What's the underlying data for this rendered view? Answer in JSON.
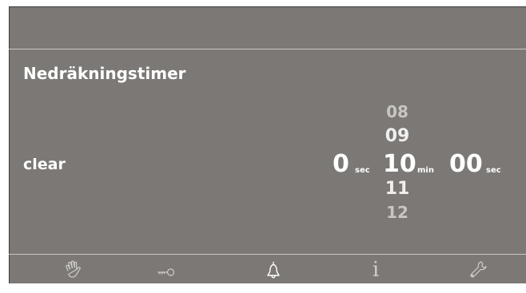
{
  "header": {
    "title": "Nedräkningstimer"
  },
  "clear_label": "clear",
  "timer": {
    "seconds_left_value": "0",
    "seconds_left_unit": "sec",
    "minutes_value": "10",
    "minutes_unit": "min",
    "seconds_value": "00",
    "seconds_unit": "sec",
    "minutes_wheel": [
      "08",
      "09",
      "11",
      "12"
    ]
  },
  "nav": {
    "icons": [
      "hand-icon",
      "key-icon",
      "bell-icon",
      "info-icon",
      "wrench-icon"
    ],
    "info_glyph": "i"
  },
  "colors": {
    "background": "#7b7875",
    "text": "#ffffff",
    "icon": "#cfcdca",
    "active_icon": "#ffffff"
  }
}
